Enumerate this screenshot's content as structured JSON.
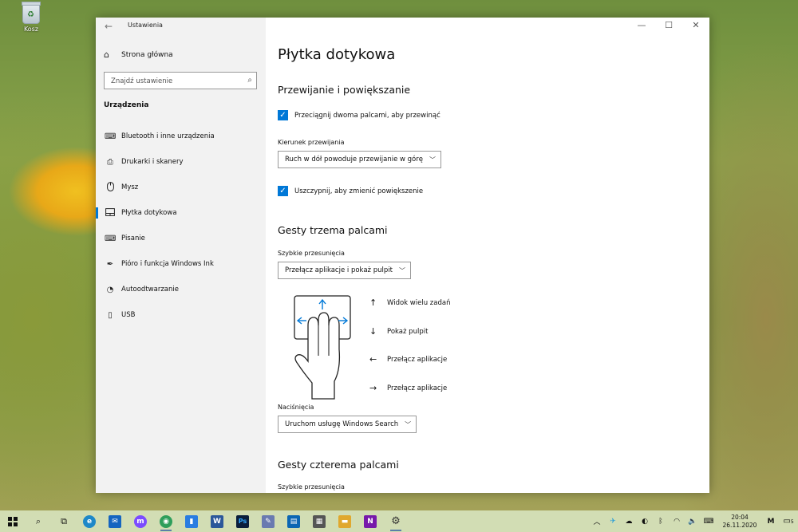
{
  "desktop": {
    "recycle_bin_label": "Kosz"
  },
  "window": {
    "title": "Ustawienia",
    "controls": {
      "minimize": "—",
      "maximize": "☐",
      "close": "✕"
    }
  },
  "sidebar": {
    "home_label": "Strona główna",
    "search_placeholder": "Znajdź ustawienie",
    "section_label": "Urządzenia",
    "items": [
      {
        "label": "Bluetooth i inne urządzenia",
        "icon": "bluetooth-devices-icon",
        "glyph": "⌨"
      },
      {
        "label": "Drukarki i skanery",
        "icon": "printer-icon",
        "glyph": "⎙"
      },
      {
        "label": "Mysz",
        "icon": "mouse-icon",
        "glyph": "🖱"
      },
      {
        "label": "Płytka dotykowa",
        "icon": "touchpad-icon",
        "glyph": "▭",
        "active": true
      },
      {
        "label": "Pisanie",
        "icon": "keyboard-icon",
        "glyph": "⌨"
      },
      {
        "label": "Pióro i funkcja Windows Ink",
        "icon": "pen-icon",
        "glyph": "✒"
      },
      {
        "label": "Autoodtwarzanie",
        "icon": "autoplay-icon",
        "glyph": "◔"
      },
      {
        "label": "USB",
        "icon": "usb-icon",
        "glyph": "▯"
      }
    ]
  },
  "main": {
    "page_title": "Płytka dotykowa",
    "scroll_zoom": {
      "heading": "Przewijanie i powiększanie",
      "two_finger_scroll_label": "Przeciągnij dwoma palcami, aby przewinąć",
      "two_finger_scroll_checked": true,
      "scroll_direction_label": "Kierunek przewijania",
      "scroll_direction_value": "Ruch w dół powoduje przewijanie w górę",
      "pinch_zoom_label": "Uszczypnij, aby zmienić powiększenie",
      "pinch_zoom_checked": true
    },
    "three_finger": {
      "heading": "Gesty trzema palcami",
      "swipes_label": "Szybkie przesunięcia",
      "swipes_value": "Przełącz aplikacje i pokaż pulpit",
      "gestures": [
        {
          "arrow": "↑",
          "label": "Widok wielu zadań"
        },
        {
          "arrow": "↓",
          "label": "Pokaż pulpit"
        },
        {
          "arrow": "←",
          "label": "Przełącz aplikacje"
        },
        {
          "arrow": "→",
          "label": "Przełącz aplikacje"
        }
      ],
      "taps_label": "Naciśnięcia",
      "taps_value": "Uruchom usługę Windows Search"
    },
    "four_finger": {
      "heading": "Gesty czterema palcami",
      "swipes_label": "Szybkie przesunięcia"
    }
  },
  "taskbar": {
    "clock_time": "20:04",
    "clock_date": "26.11.2020",
    "notification_count": "5",
    "apps": [
      {
        "name": "edge",
        "color": "#1e88c8",
        "glyph": "e"
      },
      {
        "name": "mail",
        "color": "#1565c0",
        "glyph": "✉"
      },
      {
        "name": "messenger",
        "color": "#7b4bff",
        "glyph": "m"
      },
      {
        "name": "chrome",
        "color": "#2e9e5b",
        "glyph": "◉"
      },
      {
        "name": "phone",
        "color": "#2a7de1",
        "glyph": "▮"
      },
      {
        "name": "word",
        "color": "#2b579a",
        "glyph": "W"
      },
      {
        "name": "photoshop",
        "color": "#0a1e3c",
        "glyph": "Ps"
      },
      {
        "name": "tool",
        "color": "#6a7ab0",
        "glyph": "✎"
      },
      {
        "name": "trello",
        "color": "#0c66b3",
        "glyph": "▤"
      },
      {
        "name": "calculator",
        "color": "#555555",
        "glyph": "▦"
      },
      {
        "name": "explorer",
        "color": "#e0a82e",
        "glyph": "▬"
      },
      {
        "name": "onenote",
        "color": "#7719aa",
        "glyph": "N"
      },
      {
        "name": "settings",
        "color": "#444444",
        "glyph": "⚙"
      }
    ]
  }
}
